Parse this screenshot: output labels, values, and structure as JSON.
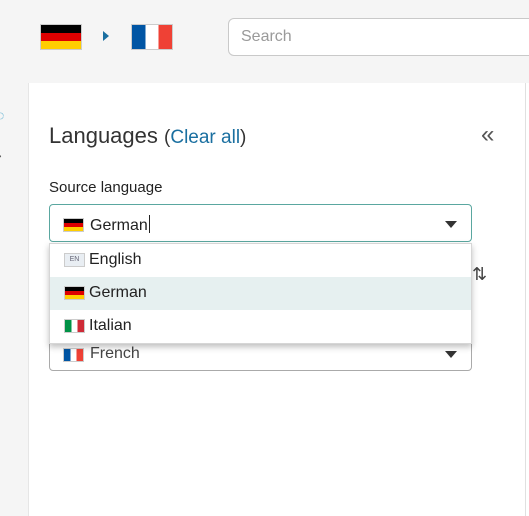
{
  "topbar": {
    "source_flag": "flag-germany-icon",
    "target_flag": "flag-france-icon",
    "search_placeholder": "Search"
  },
  "panel": {
    "title": "Languages",
    "paren_open": "(",
    "clear_all": "Clear all",
    "paren_close": ")",
    "collapse_glyph": "«",
    "source_label": "Source language",
    "source_selected": "German",
    "target_selected": "French",
    "dropdown_options": [
      {
        "code": "EN",
        "label": "English",
        "selected": false
      },
      {
        "code": "DE",
        "label": "German",
        "selected": true
      },
      {
        "code": "IT",
        "label": "Italian",
        "selected": false
      }
    ]
  },
  "colors": {
    "accent": "#1a6fa0",
    "select_border": "#5aa7a0",
    "selected_option_bg": "#e6f0f0"
  }
}
